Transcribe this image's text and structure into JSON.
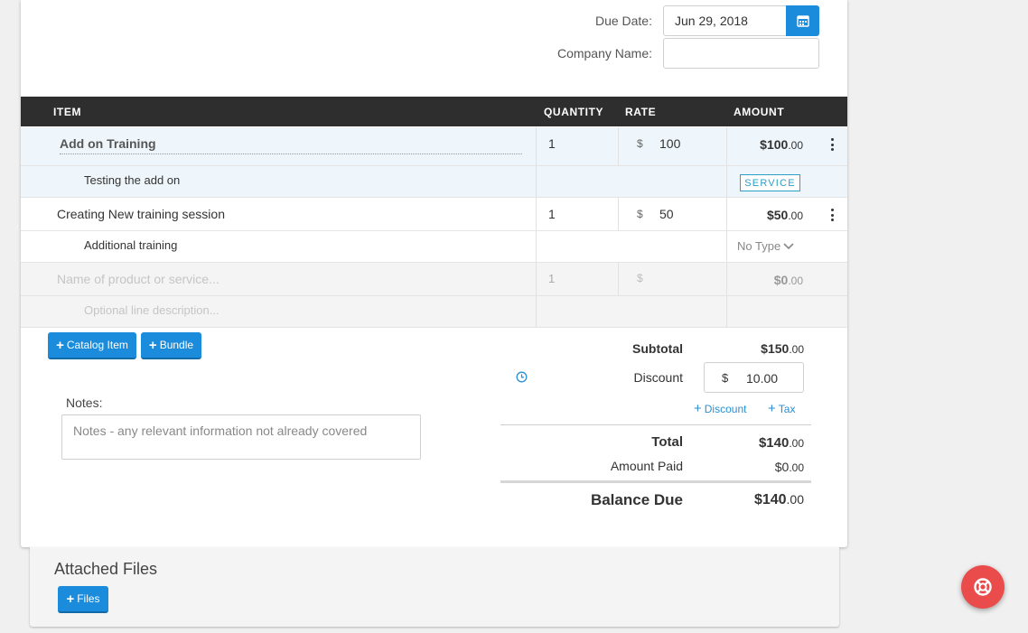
{
  "header": {
    "due_date_label": "Due Date:",
    "due_date_value": "Jun 29, 2018",
    "company_label": "Company Name:",
    "company_value": ""
  },
  "table": {
    "columns": {
      "item": "ITEM",
      "quantity": "QUANTITY",
      "rate": "RATE",
      "amount": "AMOUNT"
    },
    "currency_symbol": "$",
    "rows": [
      {
        "name": "Add on Training",
        "description": "Testing the add on",
        "quantity": "1",
        "rate": "100",
        "amount_main": "$100",
        "amount_cents": ".00",
        "type": "SERVICE"
      },
      {
        "name": "Creating New training session",
        "description": "Additional training",
        "quantity": "1",
        "rate": "50",
        "amount_main": "$50",
        "amount_cents": ".00",
        "type": "No Type"
      }
    ],
    "new_row": {
      "name_placeholder": "Name of product or service...",
      "description_placeholder": "Optional line description...",
      "quantity": "1",
      "amount_main": "$0",
      "amount_cents": ".00"
    }
  },
  "actions": {
    "catalog_item": "Catalog Item",
    "bundle": "Bundle"
  },
  "notes": {
    "label": "Notes:",
    "placeholder": "Notes - any relevant information not already covered"
  },
  "totals": {
    "subtotal_label": "Subtotal",
    "subtotal_main": "$150",
    "subtotal_cents": ".00",
    "discount_label": "Discount",
    "discount_currency": "$",
    "discount_value": "10.00",
    "add_discount": "Discount",
    "add_tax": "Tax",
    "total_label": "Total",
    "total_main": "$140",
    "total_cents": ".00",
    "amount_paid_label": "Amount Paid",
    "amount_paid_main": "$0",
    "amount_paid_cents": ".00",
    "balance_label": "Balance Due",
    "balance_main": "$140",
    "balance_cents": ".00"
  },
  "attachments": {
    "title": "Attached Files",
    "files_button": "Files"
  },
  "colors": {
    "accent": "#1b8bdc",
    "header_bg": "#2e2e2e",
    "help_fab": "#ea4c4c",
    "badge": "#2a9ec7"
  },
  "icons": [
    "calendar-icon",
    "kebab-menu-icon",
    "chevron-down-icon",
    "clock-icon",
    "plus-icon",
    "lifebuoy-icon"
  ]
}
